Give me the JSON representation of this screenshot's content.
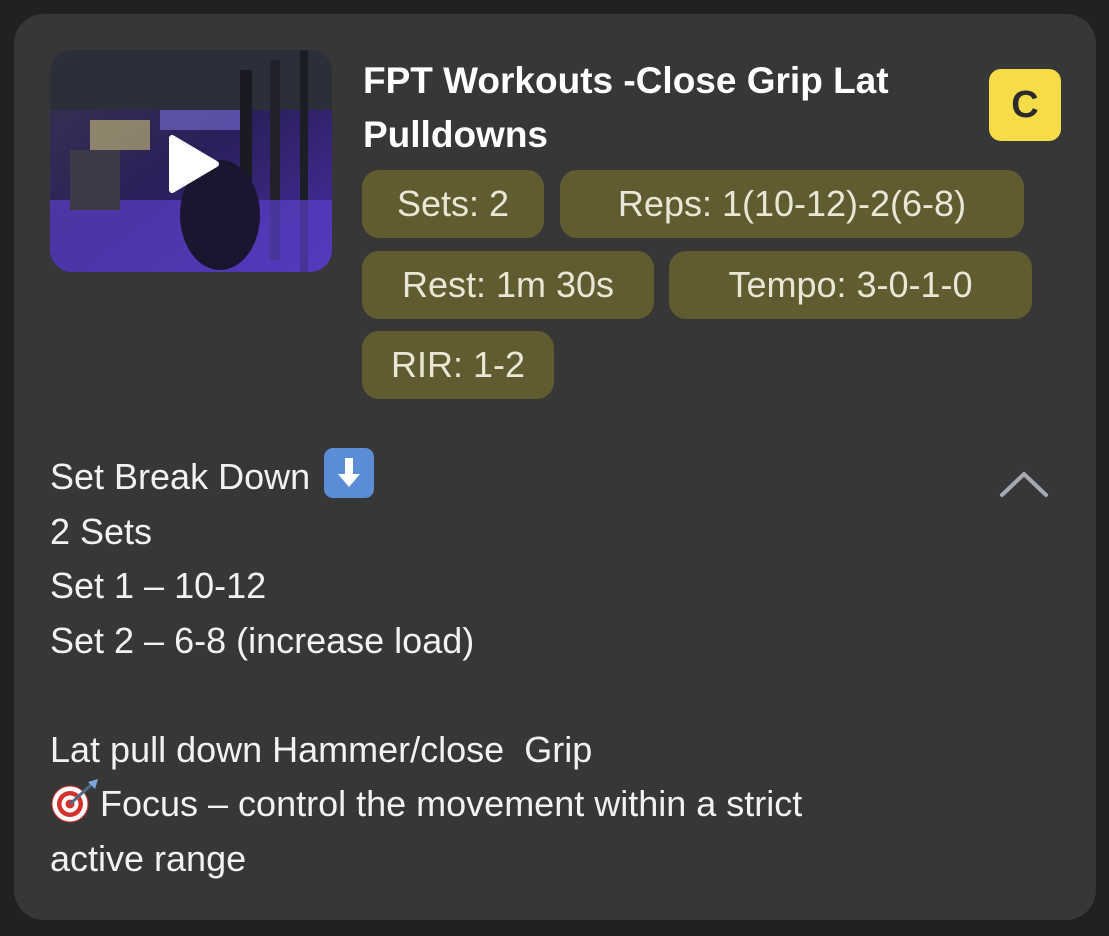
{
  "card": {
    "title": "FPT Workouts -Close Grip Lat Pulldowns",
    "badge": "C",
    "thumbnail": {
      "icon": "play-icon"
    },
    "chips": {
      "sets": "Sets: 2",
      "reps": "Reps: 1(10-12)-2(6-8)",
      "rest": "Rest: 1m 30s",
      "tempo": "Tempo: 3-0-1-0",
      "rir": "RIR: 1-2"
    },
    "collapse_icon": "chevron-up-icon",
    "description": {
      "line1": "Set Break Down",
      "line1_icon": "arrow-down-emoji",
      "line2": "2 Sets",
      "line3": "Set 1 – 10-12",
      "line4": "Set 2 – 6-8 (increase load)",
      "line5": "",
      "line6": "Lat pull down Hammer/close  Grip",
      "line7_icon": "direct-hit-emoji",
      "line7": "Focus – control the movement within a strict",
      "line8": "active range"
    }
  },
  "colors": {
    "background": "#212121",
    "card": "#373737",
    "chip": "#615b30",
    "badge": "#f6dc49",
    "text": "#ffffff"
  }
}
